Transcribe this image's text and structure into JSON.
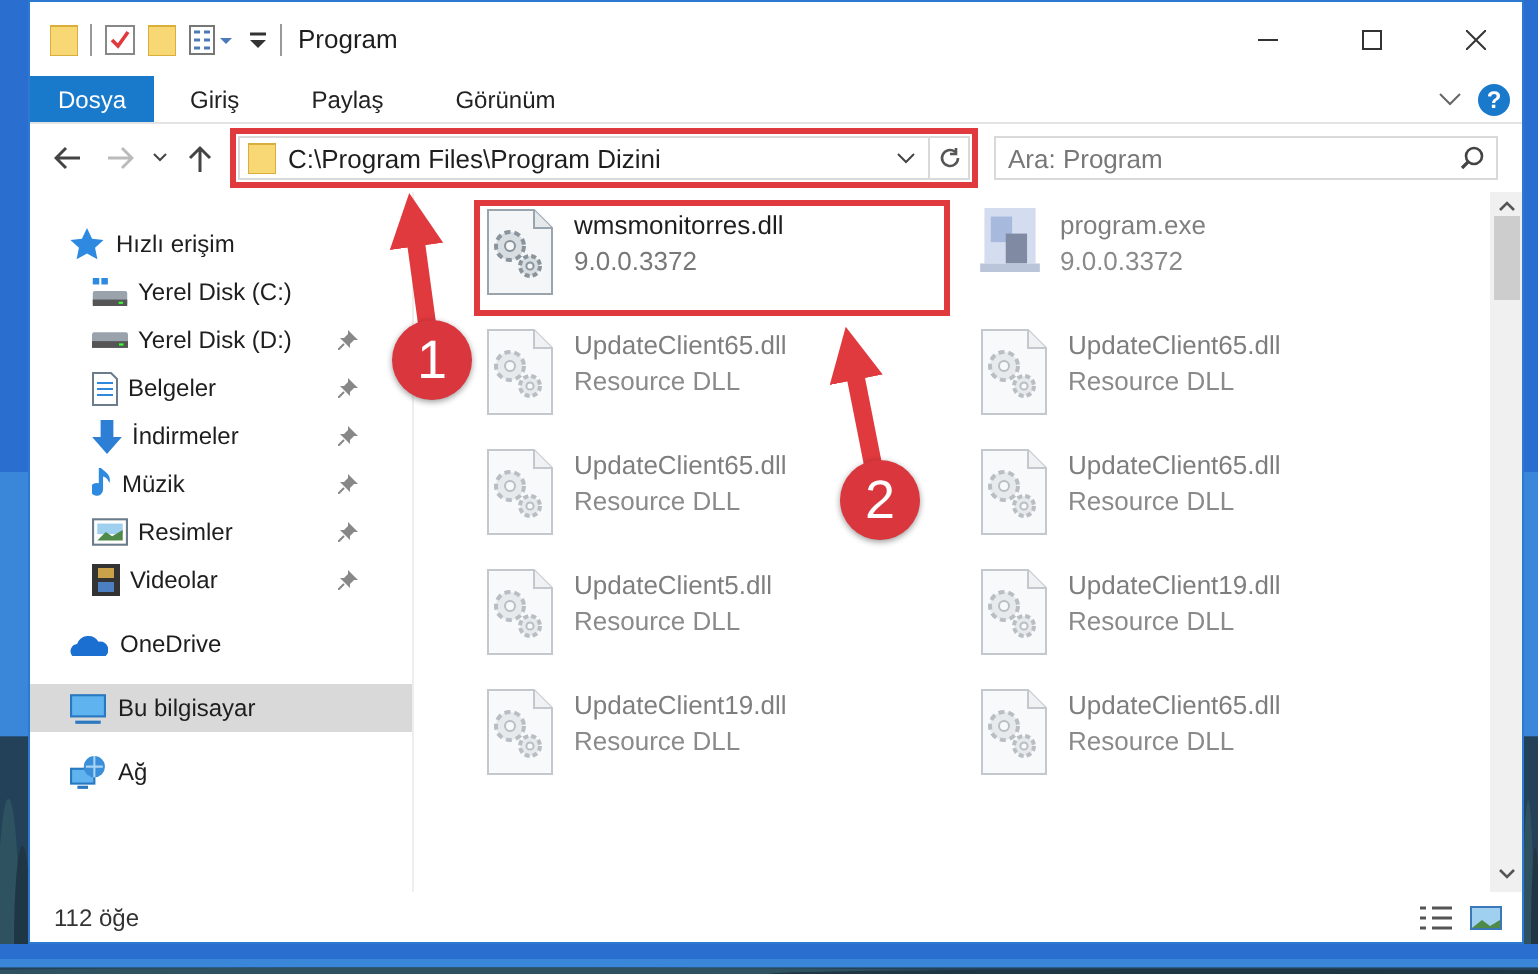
{
  "window": {
    "title": "Program",
    "help": "?"
  },
  "ribbon_tabs": [
    {
      "label": "Dosya",
      "selected": true
    },
    {
      "label": "Giriş",
      "selected": false
    },
    {
      "label": "Paylaş",
      "selected": false
    },
    {
      "label": "Görünüm",
      "selected": false
    }
  ],
  "address_bar": {
    "path": "C:\\Program Files\\Program Dizini",
    "highlighted": true
  },
  "search": {
    "placeholder": "Ara: Program"
  },
  "navigation": [
    {
      "label": "Hızlı erişim",
      "kind": "star",
      "selected": false,
      "children": [
        {
          "label": "Yerel Disk (C:)",
          "kind": "disk-c",
          "pinned": false
        },
        {
          "label": "Yerel Disk (D:)",
          "kind": "disk",
          "pinned": true
        },
        {
          "label": "Belgeler",
          "kind": "docs",
          "pinned": true
        },
        {
          "label": "İndirmeler",
          "kind": "download",
          "pinned": true
        },
        {
          "label": "Müzik",
          "kind": "music",
          "pinned": true
        },
        {
          "label": "Resimler",
          "kind": "pictures",
          "pinned": true
        },
        {
          "label": "Videolar",
          "kind": "videos",
          "pinned": true
        }
      ]
    },
    {
      "label": "OneDrive",
      "kind": "cloud",
      "selected": false
    },
    {
      "label": "Bu bilgisayar",
      "kind": "pc",
      "selected": true
    },
    {
      "label": "Ağ",
      "kind": "network",
      "selected": false
    }
  ],
  "files": [
    {
      "name": "wmsmonitorres.dll",
      "detail": "9.0.0.3372",
      "kind": "dll",
      "blurred": false,
      "highlighted": true
    },
    {
      "name": "program.exe",
      "detail": "9.0.0.3372",
      "kind": "exe",
      "blurred": true,
      "highlighted": false
    },
    {
      "name": "UpdateClient65.dll",
      "detail": "Resource DLL",
      "kind": "dll",
      "blurred": true,
      "highlighted": false
    },
    {
      "name": "UpdateClient65.dll",
      "detail": "Resource DLL",
      "kind": "dll",
      "blurred": true,
      "highlighted": false
    },
    {
      "name": "UpdateClient65.dll",
      "detail": "Resource DLL",
      "kind": "dll",
      "blurred": true,
      "highlighted": false
    },
    {
      "name": "UpdateClient65.dll",
      "detail": "Resource DLL",
      "kind": "dll",
      "blurred": true,
      "highlighted": false
    },
    {
      "name": "UpdateClient5.dll",
      "detail": "Resource DLL",
      "kind": "dll",
      "blurred": true,
      "highlighted": false
    },
    {
      "name": "UpdateClient19.dll",
      "detail": "Resource DLL",
      "kind": "dll",
      "blurred": true,
      "highlighted": false
    },
    {
      "name": "UpdateClient19.dll",
      "detail": "Resource DLL",
      "kind": "dll",
      "blurred": true,
      "highlighted": false
    },
    {
      "name": "UpdateClient65.dll",
      "detail": "Resource DLL",
      "kind": "dll",
      "blurred": true,
      "highlighted": false
    }
  ],
  "status_bar": {
    "count": "112 öğe"
  },
  "annotations": [
    {
      "number": "1"
    },
    {
      "number": "2"
    }
  ]
}
